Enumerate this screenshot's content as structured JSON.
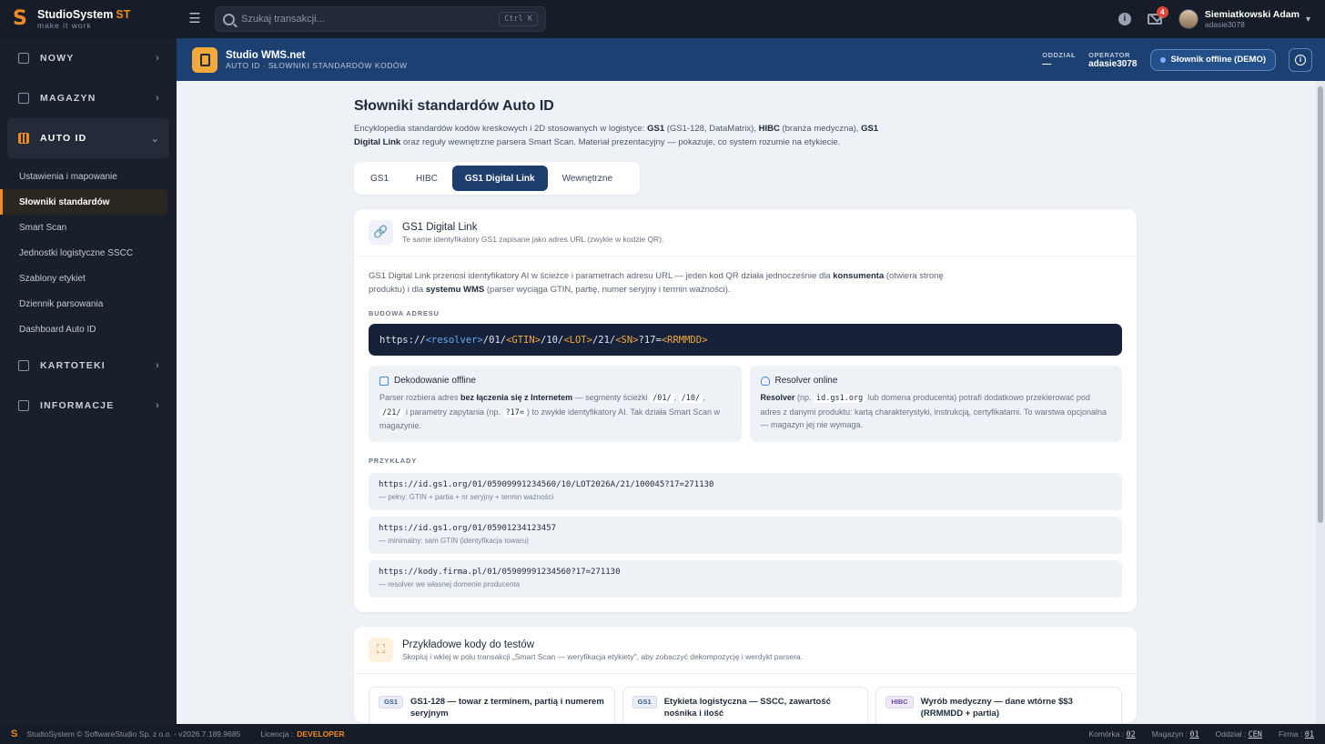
{
  "brand": {
    "name": "StudioSystem",
    "suffix": "ST",
    "tagline": "make it work"
  },
  "search": {
    "placeholder": "Szukaj transakcji...",
    "shortcut": "Ctrl K"
  },
  "notifications": {
    "mail_count": "4"
  },
  "user": {
    "name": "Siemiatkowski Adam",
    "login": "adasie3078"
  },
  "sidebar": {
    "sections": [
      {
        "label": "NOWY"
      },
      {
        "label": "MAGAZYN"
      },
      {
        "label": "AUTO ID"
      },
      {
        "label": "KARTOTEKI"
      },
      {
        "label": "INFORMACJE"
      }
    ],
    "auto_id_items": [
      {
        "label": "Ustawienia i mapowanie"
      },
      {
        "label": "Słowniki standardów"
      },
      {
        "label": "Smart Scan"
      },
      {
        "label": "Jednostki logistyczne SSCC"
      },
      {
        "label": "Szablony etykiet"
      },
      {
        "label": "Dziennik parsowania"
      },
      {
        "label": "Dashboard Auto ID"
      }
    ]
  },
  "module": {
    "title": "Studio WMS.net",
    "subtitle": "AUTO ID · SŁOWNIKI STANDARDÓW KODÓW",
    "branch_label": "ODDZIAŁ",
    "branch_value": "—",
    "operator_label": "OPERATOR",
    "operator_value": "adasie3078",
    "offline_label": "Słownik offline (DEMO)"
  },
  "page": {
    "title": "Słowniki standardów Auto ID",
    "desc_1": "Encyklopedia standardów kodów kreskowych i 2D stosowanych w logistyce: ",
    "desc_gs1": "GS1",
    "desc_2": " (GS1-128, DataMatrix), ",
    "desc_hibc": "HIBC",
    "desc_3": " (branża medyczna), ",
    "desc_dl": "GS1 Digital Link",
    "desc_4": " oraz reguły wewnętrzne parsera Smart Scan. Materiał prezentacyjny — pokazuje, co system rozumie na etykiecie.",
    "tabs": [
      {
        "label": "GS1"
      },
      {
        "label": "HIBC"
      },
      {
        "label": "GS1 Digital Link"
      },
      {
        "label": "Wewnętrzne"
      }
    ]
  },
  "digital_link": {
    "title": "GS1 Digital Link",
    "subtitle": "Te same identyfikatory GS1 zapisane jako adres URL (zwykle w kodzie QR).",
    "intro_1": "GS1 Digital Link przenosi identyfikatory AI w ścieżce i parametrach adresu URL — jeden kod QR działa jednocześnie dla ",
    "intro_b1": "konsumenta",
    "intro_2": " (otwiera stronę produktu) i dla ",
    "intro_b2": "systemu WMS",
    "intro_3": " (parser wyciąga GTIN, partię, numer seryjny i termin ważności).",
    "build_label": "BUDOWA ADRESU",
    "url": {
      "p1": "https://",
      "p2": "<resolver>",
      "p3": "/01/",
      "p4": "<GTIN>",
      "p5": "/10/",
      "p6": "<LOT>",
      "p7": "/21/",
      "p8": "<SN>",
      "p9": "?17=",
      "p10": "<RRMMDD>"
    },
    "offline_box": {
      "title": "Dekodowanie offline",
      "t1": "Parser rozbiera adres ",
      "b1": "bez łączenia się z Internetem",
      "t2": " — segmenty ścieżki ",
      "c1": "/01/",
      "t3": ", ",
      "c2": "/10/",
      "t4": ", ",
      "c3": "/21/",
      "t5": " i parametry zapytania (np. ",
      "c4": "?17=",
      "t6": ") to zwykłe identyfikatory AI. Tak działa Smart Scan w magazynie."
    },
    "online_box": {
      "title": "Resolver online",
      "b1": "Resolver",
      "t1": " (np. ",
      "c1": "id.gs1.org",
      "t2": " lub domena producenta) potrafi dodatkowo przekierować pod adres z danymi produktu: kartą charakterystyki, instrukcją, certyfikatami. To warstwa opcjonalna — magazyn jej nie wymaga."
    },
    "examples_label": "PRZYKŁADY",
    "examples": [
      {
        "url": "https://id.gs1.org/01/05909991234560/10/LOT2026A/21/100045?17=271130",
        "desc": "— pełny: GTIN + partia + nr seryjny + termin ważności"
      },
      {
        "url": "https://id.gs1.org/01/05901234123457",
        "desc": "— minimalny: sam GTIN (identyfikacja towaru)"
      },
      {
        "url": "https://kody.firma.pl/01/05909991234560?17=271130",
        "desc": "— resolver we własnej domenie producenta"
      }
    ]
  },
  "test_codes": {
    "title": "Przykładowe kody do testów",
    "subtitle": "Skopiuj i wklej w polu transakcji „Smart Scan — weryfikacja etykiety\", aby zobaczyć dekompozycję i werdykt parsera.",
    "items": [
      {
        "tag": "GS1",
        "title": "GS1-128 — towar z terminem, partią i numerem seryjnym"
      },
      {
        "tag": "GS1",
        "title": "Etykieta logistyczna — SSCC, zawartość nośnika i ilość"
      },
      {
        "tag": "HIBC",
        "title": "Wyrób medyczny — dane wtórne $$3 (RRMMDD + partia)"
      }
    ]
  },
  "footer": {
    "copyright": "StudioSystem © SoftwareStudio Sp. z o.o. - v2026.7.189.9685",
    "license_label": "Licencja :",
    "license_value": "DEVELOPER",
    "cell_label": "Komórka :",
    "cell_value": "02",
    "warehouse_label": "Magazyn :",
    "warehouse_value": "01",
    "branch_label": "Oddział :",
    "branch_value": "CEN",
    "company_label": "Firma :",
    "company_value": "01"
  },
  "colors": {
    "accent": "#f08a24",
    "header_blue": "#1d4073",
    "tab_active": "#1d3d6c"
  }
}
